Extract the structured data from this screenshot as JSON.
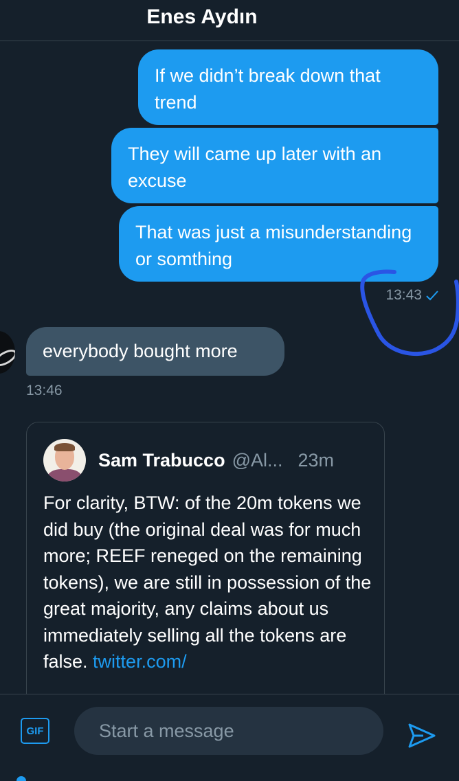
{
  "header": {
    "title": "Enes Aydın"
  },
  "messages": {
    "sent": [
      {
        "text": "If we didn’t break down that trend"
      },
      {
        "text": "They will came up later with an excuse"
      },
      {
        "text": "That was just a misunderstanding or somthing"
      }
    ],
    "sent_time": "13:43",
    "received": [
      {
        "text": "everybody bought more"
      }
    ],
    "received_time": "13:46"
  },
  "tweet": {
    "name": "Sam Trabucco",
    "handle": "@Al...",
    "time": "23m",
    "body": "For clarity, BTW: of the 20m tokens we did buy (the original deal was for much more; REEF reneged on the remaining tokens), we are still in possession of the great majority, any claims about us immediately selling all the tokens are false. ",
    "link": "twitter.com/"
  },
  "composer": {
    "gif_label": "GIF",
    "placeholder": "Start a message"
  },
  "icons": {
    "read_check": "check-icon",
    "send": "send-icon",
    "gif": "gif-icon"
  },
  "colors": {
    "background": "#15202b",
    "accent": "#1d9bf0",
    "received_bubble": "#3d5466",
    "muted_text": "#8899a6",
    "annotation": "#2a55e5"
  }
}
